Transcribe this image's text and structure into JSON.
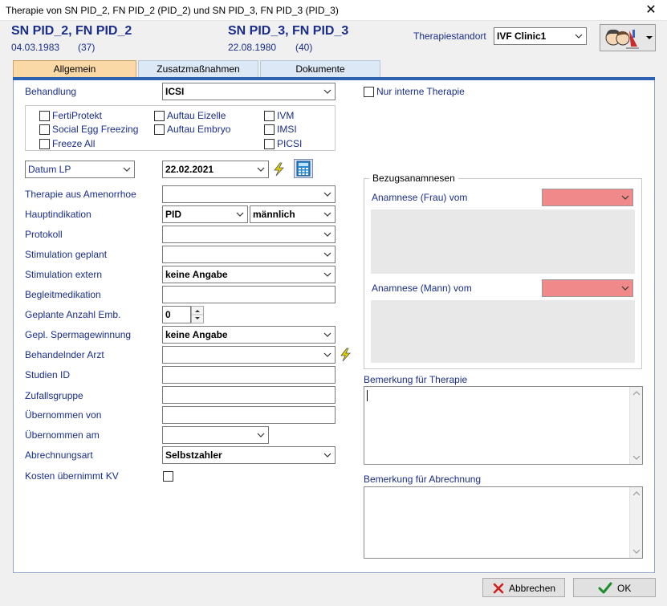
{
  "window": {
    "title": "Therapie von SN PID_2, FN PID_2 (PID_2) und SN PID_3, FN PID_3 (PID_3)"
  },
  "patients": [
    {
      "name": "SN PID_2, FN PID_2",
      "dob": "04.03.1983",
      "age": "(37)"
    },
    {
      "name": "SN PID_3, FN PID_3",
      "dob": "22.08.1980",
      "age": "(40)"
    }
  ],
  "location": {
    "label": "Therapiestandort",
    "value": "IVF Clinic1"
  },
  "tabs": [
    {
      "label": "Allgemein",
      "active": true
    },
    {
      "label": "Zusatzmaßnahmen",
      "active": false
    },
    {
      "label": "Dokumente",
      "active": false
    }
  ],
  "treatment": {
    "label": "Behandlung",
    "value": "ICSI"
  },
  "options": {
    "col1": [
      "FertiProtekt",
      "Social Egg Freezing",
      "Freeze All"
    ],
    "col2": [
      "Auftau Eizelle",
      "Auftau Embryo"
    ],
    "col3": [
      "IVM",
      "IMSI",
      "PICSI"
    ]
  },
  "internal_only": "Nur interne Therapie",
  "date": {
    "type": "Datum LP",
    "value": "22.02.2021"
  },
  "fields": {
    "amenorrhoe": {
      "label": "Therapie aus Amenorrhoe",
      "value": ""
    },
    "hauptindikation": {
      "label": "Hauptindikation",
      "value1": "PID",
      "value2": "männlich"
    },
    "protokoll": {
      "label": "Protokoll",
      "value": ""
    },
    "stim_geplant": {
      "label": "Stimulation geplant",
      "value": ""
    },
    "stim_extern": {
      "label": "Stimulation extern",
      "value": "keine Angabe"
    },
    "begleitmedikation": {
      "label": "Begleitmedikation",
      "value": ""
    },
    "anzahl_emb": {
      "label": "Geplante Anzahl Emb.",
      "value": "0"
    },
    "spermagewinnung": {
      "label": "Gepl. Spermagewinnung",
      "value": "keine Angabe"
    },
    "arzt": {
      "label": "Behandelnder Arzt",
      "value": ""
    },
    "studien_id": {
      "label": "Studien ID",
      "value": ""
    },
    "zufallsgruppe": {
      "label": "Zufallsgruppe",
      "value": ""
    },
    "uebernommen_von": {
      "label": "Übernommen von",
      "value": ""
    },
    "uebernommen_am": {
      "label": "Übernommen am",
      "value": ""
    },
    "abrechnungsart": {
      "label": "Abrechnungsart",
      "value": "Selbstzahler"
    },
    "kosten_kv": {
      "label": "Kosten übernimmt KV"
    }
  },
  "anamnesen": {
    "group_title": "Bezugsanamnesen",
    "frau_label": "Anamnese (Frau) vom",
    "mann_label": "Anamnese (Mann) vom"
  },
  "remarks": {
    "therapie": "Bemerkung für Therapie",
    "abrechnung": "Bemerkung für Abrechnung"
  },
  "buttons": {
    "cancel": "Abbrechen",
    "ok": "OK"
  },
  "colors": {
    "accent_blue": "#1a2d8c",
    "tab_active": "#fad9a6",
    "anamnese_field": "#f08a8a"
  }
}
